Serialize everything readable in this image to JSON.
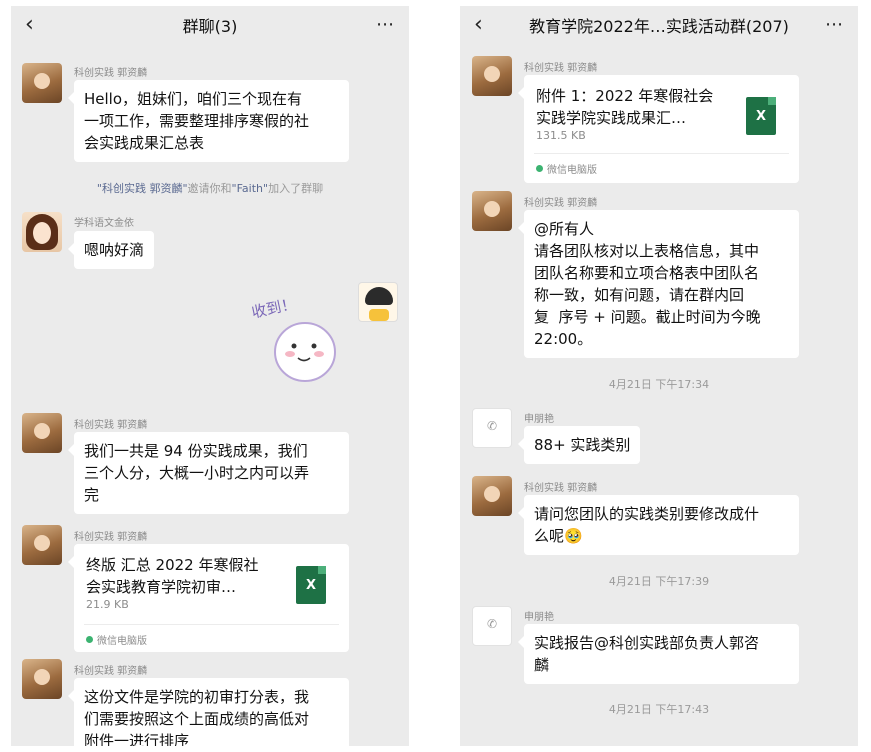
{
  "left": {
    "title": "群聊(3)",
    "messages": [
      {
        "sender": "科创实践  郭资麟",
        "text": "Hello，姐妹们，咱们三个现在有\n一项工作，需要整理排序寒假的社\n会实践成果汇总表"
      },
      {
        "system": {
          "p1": "\"科创实践  郭资麟\"",
          "p2": "邀请你和",
          "p3": "\"Faith\"",
          "p4": "加入了群聊"
        }
      },
      {
        "sender": "学科语文金依",
        "text": "嗯呐好滴"
      },
      {
        "sticker": "收到！"
      },
      {
        "sender": "科创实践  郭资麟",
        "text": "我们一共是 94 份实践成果，我们\n三个人分，大概一小时之内可以弄\n完"
      },
      {
        "sender": "科创实践  郭资麟",
        "file": {
          "name": "终版 汇总 2022 年寒假社会实践教育学院初审…",
          "size": "21.9 KB",
          "source": "微信电脑版",
          "icon": "X"
        }
      },
      {
        "sender": "科创实践  郭资麟",
        "text": "这份文件是学院的初审打分表，我\n们需要按照这个上面成绩的高低对\n附件一进行排序"
      }
    ]
  },
  "right": {
    "title": "教育学院2022年…实践活动群(207)",
    "messages": [
      {
        "sender": "科创实践  郭资麟",
        "file": {
          "name": "附件 1：2022 年寒假社会实践学院实践成果汇…",
          "size": "131.5 KB",
          "source": "微信电脑版",
          "icon": "X"
        }
      },
      {
        "sender": "科创实践  郭资麟",
        "text": "@所有人\n请各团队核对以上表格信息，其中\n团队名称要和立项合格表中团队名\n称一致，如有问题，请在群内回\n复  序号 + 问题。截止时间为今晚\n22:00。"
      },
      {
        "timestamp": "4月21日 下午17:34"
      },
      {
        "sender": "申朋艳",
        "text": "88+ 实践类别"
      },
      {
        "sender": "科创实践  郭资麟",
        "text": "请问您团队的实践类别要修改成什\n么呢🥹"
      },
      {
        "timestamp": "4月21日 下午17:39"
      },
      {
        "sender": "申朋艳",
        "text": "实践报告@科创实践部负责人郭咨\n麟"
      },
      {
        "timestamp": "4月21日 下午17:43"
      }
    ]
  },
  "icons": {
    "back": "back-chevron-icon",
    "more": "more-dots-icon",
    "file": "excel-file-icon",
    "source": "wechat-pc-dot-icon"
  },
  "colors": {
    "chat_bg": "#ebebeb",
    "bubble": "#ffffff",
    "excel": "#1e7145",
    "system_highlight": "#5b6a91"
  }
}
